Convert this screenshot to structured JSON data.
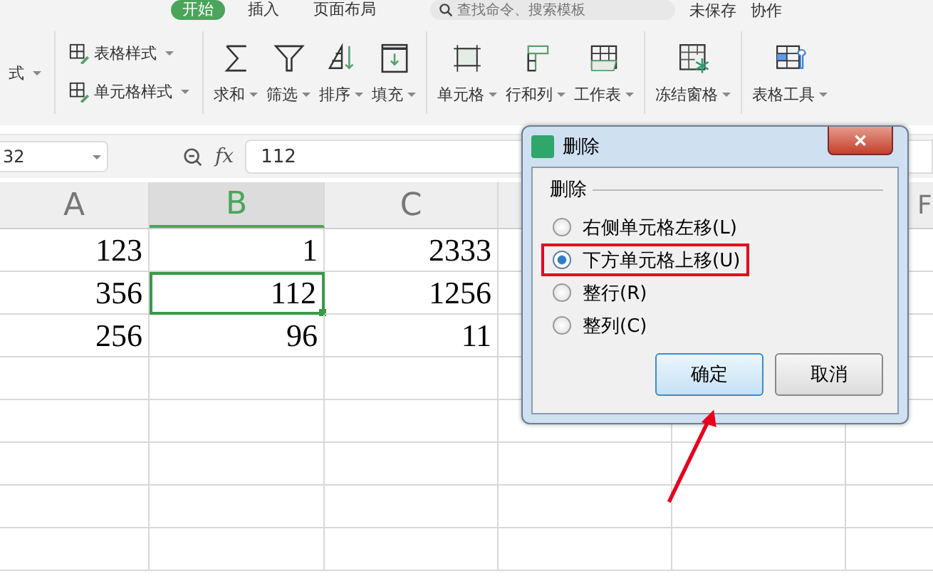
{
  "menu_tabs": [
    {
      "label": "开始",
      "selected": true
    },
    {
      "label": "插入",
      "selected": false
    },
    {
      "label": "页面布局",
      "selected": false
    }
  ],
  "search": {
    "placeholder": "查找命令、搜索模板"
  },
  "status_links": [
    "未保存",
    "协作"
  ],
  "ribbon": {
    "small_groups": [
      [
        {
          "label": "式"
        }
      ],
      [
        {
          "label": "表格样式"
        },
        {
          "label": "单元格样式"
        }
      ]
    ],
    "large_groups": [
      [
        {
          "label": "求和"
        },
        {
          "label": "筛选"
        },
        {
          "label": "排序"
        },
        {
          "label": "填充"
        }
      ],
      [
        {
          "label": "单元格"
        },
        {
          "label": "行和列"
        },
        {
          "label": "工作表"
        }
      ],
      [
        {
          "label": "冻结窗格"
        }
      ],
      [
        {
          "label": "表格工具"
        }
      ]
    ]
  },
  "formula_bar": {
    "name_box": "32",
    "fx": "fx",
    "value": "112"
  },
  "sheet": {
    "columns": [
      {
        "label": "A",
        "selected": false
      },
      {
        "label": "B",
        "selected": true
      },
      {
        "label": "C",
        "selected": false
      },
      {
        "label": "F",
        "selected": false
      }
    ],
    "rows": [
      {
        "cells": [
          {
            "value": "123",
            "selected": false
          },
          {
            "value": "1",
            "selected": false
          },
          {
            "value": "2333",
            "selected": false
          }
        ]
      },
      {
        "cells": [
          {
            "value": "356",
            "selected": false
          },
          {
            "value": "112",
            "selected": true
          },
          {
            "value": "1256",
            "selected": false
          }
        ]
      },
      {
        "cells": [
          {
            "value": "256",
            "selected": false
          },
          {
            "value": "96",
            "selected": false
          },
          {
            "value": "11",
            "selected": false
          }
        ]
      }
    ]
  },
  "dialog": {
    "title": "删除",
    "close": "✕",
    "group_label": "删除",
    "options": [
      {
        "label": "右侧单元格左移(L)",
        "selected": false,
        "highlighted": false
      },
      {
        "label": "下方单元格上移(U)",
        "selected": true,
        "highlighted": true
      },
      {
        "label": "整行(R)",
        "selected": false,
        "highlighted": false
      },
      {
        "label": "整列(C)",
        "selected": false,
        "highlighted": false
      }
    ],
    "buttons": [
      {
        "label": "确定",
        "kind": "primary"
      },
      {
        "label": "取消",
        "kind": "normal"
      }
    ]
  }
}
